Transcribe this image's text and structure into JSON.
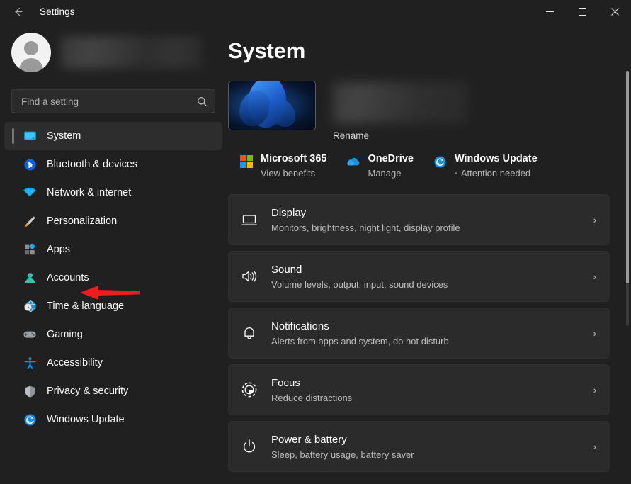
{
  "window": {
    "title": "Settings",
    "back_icon": "back-arrow-icon",
    "minimize_label": "Minimize",
    "maximize_label": "Maximize",
    "close_label": "Close"
  },
  "account": {
    "name_redacted": "",
    "avatar_icon": "person-avatar-icon"
  },
  "search": {
    "placeholder": "Find a setting",
    "value": "",
    "icon": "search-icon"
  },
  "sidebar": {
    "items": [
      {
        "label": "System",
        "icon": "monitor-icon",
        "selected": true
      },
      {
        "label": "Bluetooth & devices",
        "icon": "bluetooth-icon",
        "selected": false
      },
      {
        "label": "Network & internet",
        "icon": "wifi-icon",
        "selected": false
      },
      {
        "label": "Personalization",
        "icon": "paintbrush-icon",
        "selected": false
      },
      {
        "label": "Apps",
        "icon": "apps-icon",
        "selected": false
      },
      {
        "label": "Accounts",
        "icon": "person-icon",
        "selected": false
      },
      {
        "label": "Time & language",
        "icon": "clock-globe-icon",
        "selected": false
      },
      {
        "label": "Gaming",
        "icon": "gamepad-icon",
        "selected": false
      },
      {
        "label": "Accessibility",
        "icon": "accessibility-icon",
        "selected": false
      },
      {
        "label": "Privacy & security",
        "icon": "shield-icon",
        "selected": false
      },
      {
        "label": "Windows Update",
        "icon": "update-icon",
        "selected": false
      }
    ]
  },
  "main": {
    "page_title": "System",
    "device": {
      "name_redacted": "",
      "rename_label": "Rename",
      "thumbnail": "windows-bloom-wallpaper"
    },
    "services": [
      {
        "title": "Microsoft 365",
        "subtitle": "View benefits",
        "icon": "microsoft-logo-icon",
        "status_dot": false
      },
      {
        "title": "OneDrive",
        "subtitle": "Manage",
        "icon": "onedrive-cloud-icon",
        "status_dot": false
      },
      {
        "title": "Windows Update",
        "subtitle": "Attention needed",
        "icon": "update-icon",
        "status_dot": true
      }
    ],
    "cards": [
      {
        "title": "Display",
        "subtitle": "Monitors, brightness, night light, display profile",
        "icon": "display-monitor-icon"
      },
      {
        "title": "Sound",
        "subtitle": "Volume levels, output, input, sound devices",
        "icon": "speaker-icon"
      },
      {
        "title": "Notifications",
        "subtitle": "Alerts from apps and system, do not disturb",
        "icon": "bell-icon"
      },
      {
        "title": "Focus",
        "subtitle": "Reduce distractions",
        "icon": "focus-icon"
      },
      {
        "title": "Power & battery",
        "subtitle": "Sleep, battery usage, battery saver",
        "icon": "power-icon"
      }
    ],
    "chevron": "›"
  },
  "annotation": {
    "arrow_color": "#ef1c1c",
    "points_to": "Apps"
  },
  "colors": {
    "page_bg": "#202020",
    "card_bg": "#2b2b2b",
    "accent_blue": "#4cc2ff",
    "selected_bg": "#2d2d2d",
    "subtitle": "#bdbdbd"
  }
}
